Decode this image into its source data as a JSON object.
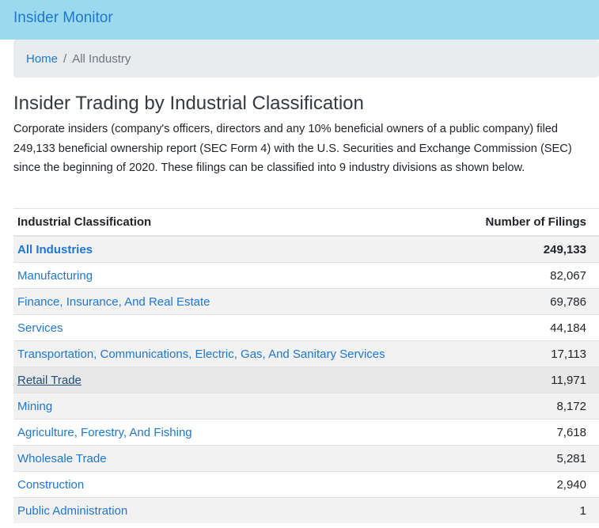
{
  "navbar": {
    "brand": "Insider Monitor",
    "bg_color": "#9ad9ee",
    "brand_color": "#1f77d0"
  },
  "breadcrumb": {
    "home": "Home",
    "separator": "/",
    "current": "All Industry"
  },
  "page": {
    "title": "Insider Trading by Industrial Classification",
    "intro": "Corporate insiders (company's officers, directors and any 10% beneficial owners of a public company) filed 249,133 beneficial ownership report (SEC Form 4) with the U.S. Securities and Exchange Commission (SEC) since the beginning of 2020. These filings can be classified into 9 industry divisions as shown below."
  },
  "table": {
    "headers": [
      "Industrial Classification",
      "Number of Filings"
    ],
    "rows": [
      {
        "label": "All Industries",
        "value": "249,133",
        "bold": true
      },
      {
        "label": "Manufacturing",
        "value": "82,067"
      },
      {
        "label": "Finance, Insurance, And Real Estate",
        "value": "69,786"
      },
      {
        "label": "Services",
        "value": "44,184"
      },
      {
        "label": "Transportation, Communications, Electric, Gas, And Sanitary Services",
        "value": "17,113"
      },
      {
        "label": "Retail Trade",
        "value": "11,971",
        "hovered": true
      },
      {
        "label": "Mining",
        "value": "8,172"
      },
      {
        "label": "Agriculture, Forestry, And Fishing",
        "value": "7,618"
      },
      {
        "label": "Wholesale Trade",
        "value": "5,281"
      },
      {
        "label": "Construction",
        "value": "2,940"
      },
      {
        "label": "Public Administration",
        "value": "1"
      }
    ]
  }
}
